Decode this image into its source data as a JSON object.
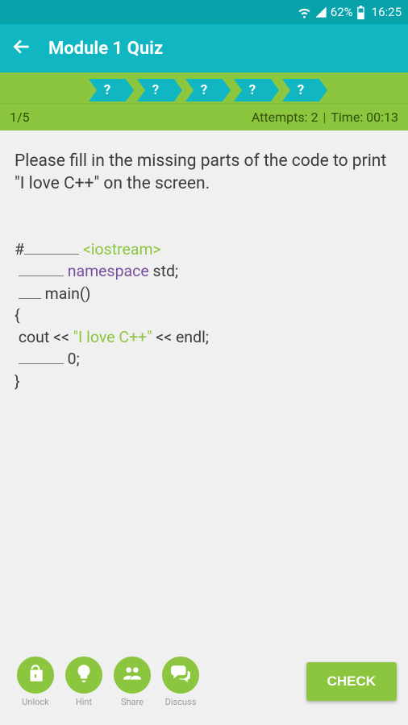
{
  "status": {
    "battery": "62%",
    "time": "16:25"
  },
  "appbar": {
    "title": "Module 1 Quiz"
  },
  "progress": {
    "marks": [
      "?",
      "?",
      "?",
      "?",
      "?"
    ]
  },
  "info": {
    "counter": "1/5",
    "attempts_label": "Attempts: 2",
    "time_label": "Time: 00:13"
  },
  "question": {
    "prompt": "Please fill in the missing parts of the code to print \"I love C++\" on the screen.",
    "code": {
      "hash": "#",
      "iostream": "<iostream>",
      "namespace": "namespace",
      "std": " std;",
      "main": " main()",
      "lbrace": "{",
      "cout_pre": " cout << ",
      "str": "\"I love C++\"",
      "cout_post": " << endl;",
      "zero": " 0;",
      "rbrace": "}"
    }
  },
  "actions": {
    "unlock": "Unlock",
    "hint": "Hint",
    "share": "Share",
    "discuss": "Discuss",
    "check": "CHECK"
  }
}
